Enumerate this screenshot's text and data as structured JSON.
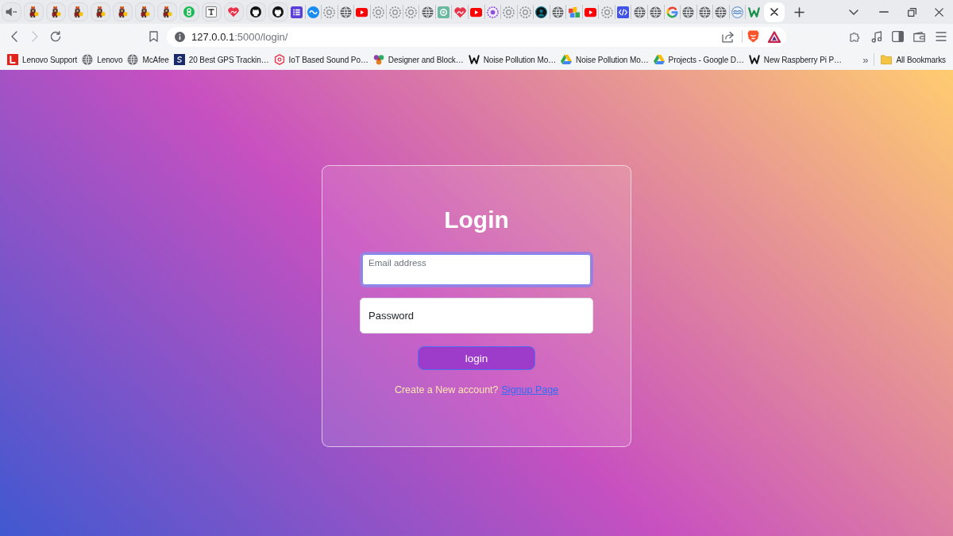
{
  "tabs": [
    {
      "kind": "audio",
      "pinned": true,
      "selected": false
    },
    {
      "kind": "sprite",
      "pinned": true,
      "selected": false
    },
    {
      "kind": "sprite",
      "pinned": true,
      "selected": false
    },
    {
      "kind": "sprite",
      "pinned": true,
      "selected": false
    },
    {
      "kind": "sprite",
      "pinned": true,
      "selected": false
    },
    {
      "kind": "sprite",
      "pinned": true,
      "selected": false
    },
    {
      "kind": "sprite",
      "pinned": true,
      "selected": false
    },
    {
      "kind": "sprite",
      "pinned": true,
      "selected": false
    },
    {
      "kind": "chain",
      "pinned": true,
      "selected": false
    },
    {
      "kind": "tbox",
      "pinned": true,
      "selected": false
    },
    {
      "kind": "heart",
      "pinned": true,
      "selected": false
    },
    {
      "kind": "octocat",
      "pinned": true,
      "selected": false
    },
    {
      "kind": "octocat",
      "pinned": true,
      "selected": false
    },
    {
      "kind": "list",
      "pinned": false,
      "selected": false
    },
    {
      "kind": "infinity",
      "pinned": false,
      "selected": false
    },
    {
      "kind": "dashed",
      "pinned": false,
      "selected": false
    },
    {
      "kind": "globe",
      "pinned": false,
      "selected": false
    },
    {
      "kind": "video",
      "pinned": false,
      "selected": false
    },
    {
      "kind": "dashed",
      "pinned": false,
      "selected": false
    },
    {
      "kind": "dashed",
      "pinned": false,
      "selected": false
    },
    {
      "kind": "dashed",
      "pinned": false,
      "selected": false
    },
    {
      "kind": "globe",
      "pinned": false,
      "selected": false
    },
    {
      "kind": "knot",
      "pinned": false,
      "selected": false
    },
    {
      "kind": "heart",
      "pinned": false,
      "selected": false
    },
    {
      "kind": "video",
      "pinned": false,
      "selected": false
    },
    {
      "kind": "badge",
      "pinned": false,
      "selected": false
    },
    {
      "kind": "dashed",
      "pinned": false,
      "selected": false
    },
    {
      "kind": "dashed",
      "pinned": false,
      "selected": false
    },
    {
      "kind": "avatar",
      "pinned": false,
      "selected": false
    },
    {
      "kind": "globe",
      "pinned": false,
      "selected": false
    },
    {
      "kind": "blocks",
      "pinned": false,
      "selected": false
    },
    {
      "kind": "video",
      "pinned": false,
      "selected": false
    },
    {
      "kind": "dashed",
      "pinned": false,
      "selected": false
    },
    {
      "kind": "code",
      "pinned": false,
      "selected": false
    },
    {
      "kind": "globe",
      "pinned": false,
      "selected": false
    },
    {
      "kind": "globe",
      "pinned": false,
      "selected": false
    },
    {
      "kind": "gmark",
      "pinned": false,
      "selected": false
    },
    {
      "kind": "globe",
      "pinned": false,
      "selected": false
    },
    {
      "kind": "globe",
      "pinned": false,
      "selected": false
    },
    {
      "kind": "globe",
      "pinned": false,
      "selected": false
    },
    {
      "kind": "ripple",
      "pinned": false,
      "selected": false
    },
    {
      "kind": "wmark",
      "pinned": false,
      "selected": false
    },
    {
      "pinned": false,
      "selected": true
    }
  ],
  "navigation": [
    {
      "kind": "back",
      "disabled": false
    },
    {
      "kind": "forward",
      "disabled": true
    },
    {
      "kind": "reload",
      "disabled": false
    }
  ],
  "address_bar": {
    "host": "127.0.0.1",
    "path": ":5000/login/"
  },
  "bookmarks": [
    {
      "label": "Lenovo Support",
      "kind": "lenovo"
    },
    {
      "label": "Lenovo",
      "kind": "globe"
    },
    {
      "label": "McAfee",
      "kind": "globe"
    },
    {
      "label": "20 Best GPS Trackin…",
      "kind": "serif"
    },
    {
      "label": "IoT Based Sound Po…",
      "kind": "hexagon"
    },
    {
      "label": "Designer and Block…",
      "kind": "flower"
    },
    {
      "label": "Noise Pollution Mo…",
      "kind": "wsketch"
    },
    {
      "label": "Noise Pollution Mo…",
      "kind": "drive"
    },
    {
      "label": "Projects - Google D…",
      "kind": "drive"
    },
    {
      "label": "New Raspberry Pi P…",
      "kind": "wsketch"
    }
  ],
  "bookmarks_overflow": "»",
  "bookmarks_folder": "All Bookmarks",
  "page": {
    "title": "Login",
    "fields": [
      {
        "placeholder": "Email address",
        "focused": true
      },
      {
        "placeholder": "Password",
        "focused": false
      }
    ],
    "button": "login",
    "signup": {
      "prompt": "Create a New account?",
      "link": "Signup Page"
    }
  }
}
